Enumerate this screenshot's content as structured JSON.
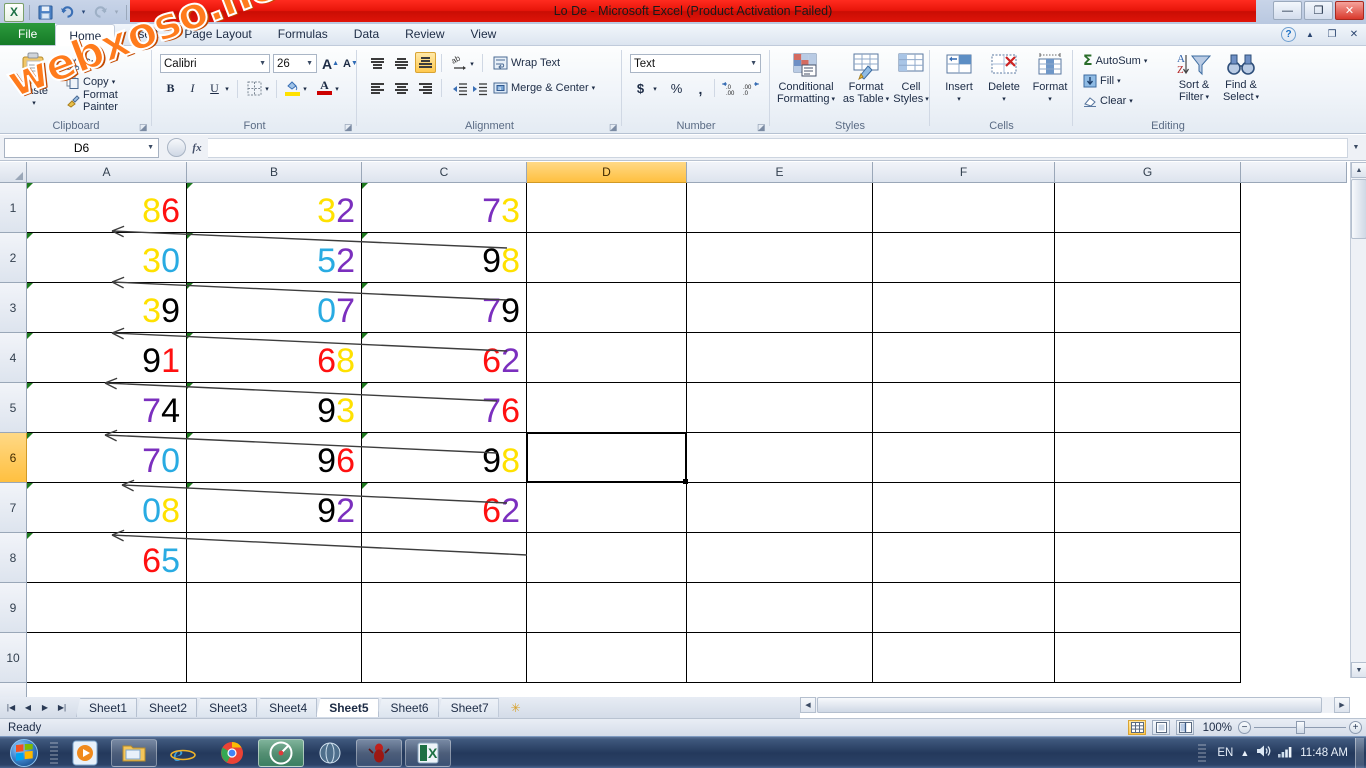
{
  "window": {
    "title": "Lo De  -  Microsoft Excel (Product Activation Failed)",
    "minimize": "—",
    "restore": "❐",
    "close": "✕",
    "watermark": "webxoso.net"
  },
  "quick_access": {
    "save": "💾",
    "undo": "↰",
    "redo": "↱",
    "customize": "▾"
  },
  "ribbon": {
    "tabs": [
      {
        "label": "File",
        "active": false,
        "file": true
      },
      {
        "label": "Home",
        "active": true
      },
      {
        "label": "Insert",
        "active": false
      },
      {
        "label": "Page Layout",
        "active": false
      },
      {
        "label": "Formulas",
        "active": false
      },
      {
        "label": "Data",
        "active": false
      },
      {
        "label": "Review",
        "active": false
      },
      {
        "label": "View",
        "active": false
      }
    ],
    "help_icon": "?",
    "minimize_ribbon_icon": "▲",
    "restore_ribbon_icon": "❐",
    "close_ribbon_icon": "✕",
    "clipboard": {
      "group_label": "Clipboard",
      "paste_label": "Paste",
      "cut_label": "Cut",
      "copy_label": "Copy",
      "format_painter_label": "Format Painter"
    },
    "font": {
      "group_label": "Font",
      "font_name": "Calibri",
      "font_size": "26",
      "grow_font": "A",
      "shrink_font": "A",
      "bold": "B",
      "italic": "I",
      "underline": "U",
      "borders": "▦",
      "fill_color": "A",
      "font_color": "A"
    },
    "alignment": {
      "group_label": "Alignment",
      "wrap_text_label": "Wrap Text",
      "merge_center_label": "Merge & Center",
      "vertical_active": "bottom-align"
    },
    "number": {
      "group_label": "Number",
      "format": "Text",
      "currency": "$",
      "percent": "%",
      "comma": ",",
      "increase_decimal": ".00",
      "decrease_decimal": ".00"
    },
    "styles": {
      "group_label": "Styles",
      "conditional_formatting": "Conditional\nFormatting",
      "conditional_line1": "Conditional",
      "conditional_line2": "Formatting",
      "format_as_table_line1": "Format",
      "format_as_table_line2": "as Table",
      "cell_styles_line1": "Cell",
      "cell_styles_line2": "Styles"
    },
    "cells": {
      "group_label": "Cells",
      "insert": "Insert",
      "delete": "Delete",
      "format": "Format"
    },
    "editing": {
      "group_label": "Editing",
      "autosum": "AutoSum",
      "fill": "Fill",
      "clear": "Clear",
      "sort_filter_line1": "Sort &",
      "sort_filter_line2": "Filter",
      "find_select_line1": "Find &",
      "find_select_line2": "Select"
    }
  },
  "formula_bar": {
    "name_box": "D6",
    "fx_label": "fx",
    "formula_value": "",
    "cancel_icon": "✕",
    "enter_icon": "✓"
  },
  "grid": {
    "columns": [
      "A",
      "B",
      "C",
      "D",
      "E",
      "F",
      "G"
    ],
    "selected_column": "D",
    "rows": [
      "1",
      "2",
      "3",
      "4",
      "5",
      "6",
      "7",
      "8",
      "9",
      "10"
    ],
    "selected_row": "6",
    "selected_cell": "D6",
    "colors": {
      "yellow": "#FFE100",
      "red": "#FF1010",
      "cyan": "#29ABE2",
      "purple": "#7B2FBE",
      "black": "#000000"
    },
    "data": [
      {
        "row": "1",
        "A": [
          {
            "d": "8",
            "c": "yellow"
          },
          {
            "d": "6",
            "c": "red"
          }
        ],
        "B": [
          {
            "d": "3",
            "c": "yellow"
          },
          {
            "d": "2",
            "c": "purple"
          }
        ],
        "C": [
          {
            "d": "7",
            "c": "purple"
          },
          {
            "d": "3",
            "c": "yellow"
          }
        ]
      },
      {
        "row": "2",
        "A": [
          {
            "d": "3",
            "c": "yellow"
          },
          {
            "d": "0",
            "c": "cyan"
          }
        ],
        "B": [
          {
            "d": "5",
            "c": "cyan"
          },
          {
            "d": "2",
            "c": "purple"
          }
        ],
        "C": [
          {
            "d": "9",
            "c": "black"
          },
          {
            "d": "8",
            "c": "yellow"
          }
        ]
      },
      {
        "row": "3",
        "A": [
          {
            "d": "3",
            "c": "yellow"
          },
          {
            "d": "9",
            "c": "black"
          }
        ],
        "B": [
          {
            "d": "0",
            "c": "cyan"
          },
          {
            "d": "7",
            "c": "purple"
          }
        ],
        "C": [
          {
            "d": "7",
            "c": "purple"
          },
          {
            "d": "9",
            "c": "black"
          }
        ]
      },
      {
        "row": "4",
        "A": [
          {
            "d": "9",
            "c": "black"
          },
          {
            "d": "1",
            "c": "red"
          }
        ],
        "B": [
          {
            "d": "6",
            "c": "red"
          },
          {
            "d": "8",
            "c": "yellow"
          }
        ],
        "C": [
          {
            "d": "6",
            "c": "red"
          },
          {
            "d": "2",
            "c": "purple"
          }
        ]
      },
      {
        "row": "5",
        "A": [
          {
            "d": "7",
            "c": "purple"
          },
          {
            "d": "4",
            "c": "black"
          }
        ],
        "B": [
          {
            "d": "9",
            "c": "black"
          },
          {
            "d": "3",
            "c": "yellow"
          }
        ],
        "C": [
          {
            "d": "7",
            "c": "purple"
          },
          {
            "d": "6",
            "c": "red"
          }
        ]
      },
      {
        "row": "6",
        "A": [
          {
            "d": "7",
            "c": "purple"
          },
          {
            "d": "0",
            "c": "cyan"
          }
        ],
        "B": [
          {
            "d": "9",
            "c": "black"
          },
          {
            "d": "6",
            "c": "red"
          }
        ],
        "C": [
          {
            "d": "9",
            "c": "black"
          },
          {
            "d": "8",
            "c": "yellow"
          }
        ]
      },
      {
        "row": "7",
        "A": [
          {
            "d": "0",
            "c": "cyan"
          },
          {
            "d": "8",
            "c": "yellow"
          }
        ],
        "B": [
          {
            "d": "9",
            "c": "black"
          },
          {
            "d": "2",
            "c": "purple"
          }
        ],
        "C": [
          {
            "d": "6",
            "c": "red"
          },
          {
            "d": "2",
            "c": "purple"
          }
        ]
      },
      {
        "row": "8",
        "A": [
          {
            "d": "6",
            "c": "red"
          },
          {
            "d": "5",
            "c": "cyan"
          }
        ],
        "B": [],
        "C": []
      },
      {
        "row": "9",
        "A": [],
        "B": [],
        "C": []
      },
      {
        "row": "10",
        "A": [],
        "B": [],
        "C": []
      }
    ]
  },
  "sheet_tabs": {
    "first_icon": "|◀",
    "prev_icon": "◀",
    "next_icon": "▶",
    "last_icon": "▶|",
    "tabs": [
      {
        "label": "Sheet1",
        "active": false
      },
      {
        "label": "Sheet2",
        "active": false
      },
      {
        "label": "Sheet3",
        "active": false
      },
      {
        "label": "Sheet4",
        "active": false
      },
      {
        "label": "Sheet5",
        "active": true
      },
      {
        "label": "Sheet6",
        "active": false
      },
      {
        "label": "Sheet7",
        "active": false
      }
    ],
    "insert_sheet_icon": "✳"
  },
  "status_bar": {
    "mode": "Ready",
    "view_normal": "▦",
    "view_page_layout": "▤",
    "view_page_break": "▥",
    "zoom": "100%",
    "zoom_out": "−",
    "zoom_in": "+"
  },
  "taskbar": {
    "start": "start-orb",
    "items": [
      {
        "name": "media-player-icon",
        "glyph": "▶",
        "state": "pinned"
      },
      {
        "name": "file-explorer-icon",
        "glyph": "🗂",
        "state": "framed"
      },
      {
        "name": "internet-explorer-icon",
        "glyph": "e",
        "state": "pinned"
      },
      {
        "name": "chrome-icon",
        "glyph": "◉",
        "state": "pinned"
      },
      {
        "name": "app-green-icon",
        "glyph": "◎",
        "state": "active"
      },
      {
        "name": "browser-icon",
        "glyph": "◍",
        "state": "pinned"
      },
      {
        "name": "ant-app-icon",
        "glyph": "♟",
        "state": "framed"
      },
      {
        "name": "excel-icon",
        "glyph": "X",
        "state": "framed"
      }
    ],
    "tray": {
      "language": "EN",
      "show_hidden": "▲",
      "volume": "🔊",
      "network": "▮",
      "clock": "11:48 AM"
    }
  }
}
